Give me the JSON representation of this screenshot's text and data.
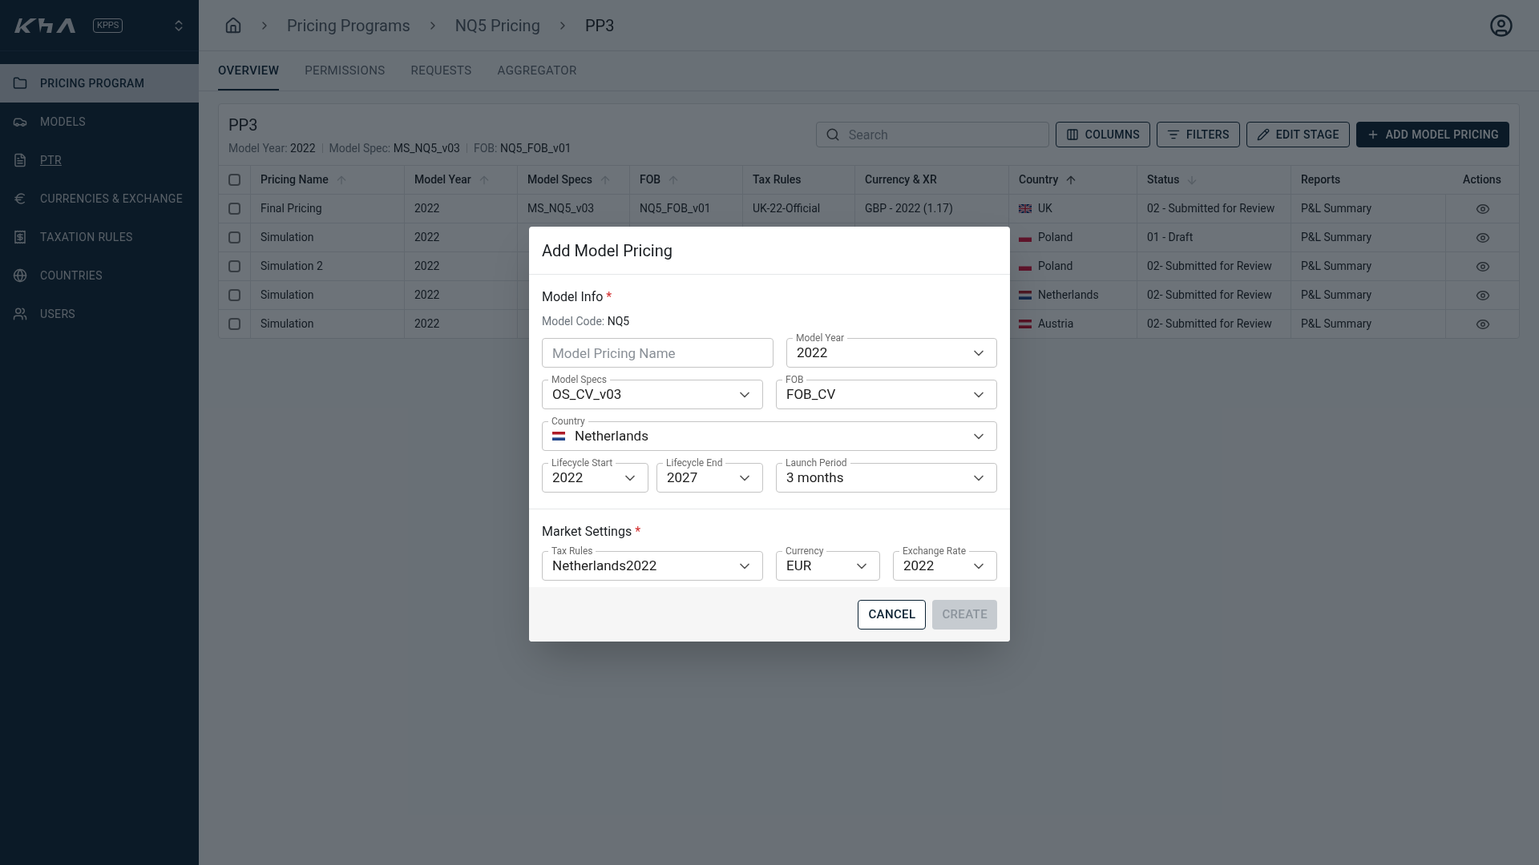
{
  "sidebar": {
    "badge": "KPPS",
    "items": [
      {
        "label": "PRICING PROGRAM",
        "selected": true,
        "link": false
      },
      {
        "label": "MODELS",
        "selected": false,
        "link": false
      },
      {
        "label": "PTR",
        "selected": false,
        "link": true
      },
      {
        "label": "CURRENCIES & EXCHANGE",
        "selected": false,
        "link": false
      },
      {
        "label": "TAXATION RULES",
        "selected": false,
        "link": false
      },
      {
        "label": "COUNTRIES",
        "selected": false,
        "link": false
      },
      {
        "label": "USERS",
        "selected": false,
        "link": false
      }
    ]
  },
  "breadcrumb": [
    "Pricing Programs",
    "NQ5 Pricing",
    "PP3"
  ],
  "tabs": [
    {
      "label": "OVERVIEW",
      "selected": true
    },
    {
      "label": "PERMISSIONS",
      "selected": false
    },
    {
      "label": "REQUESTS",
      "selected": false
    },
    {
      "label": "AGGREGATOR",
      "selected": false
    }
  ],
  "card": {
    "title": "PP3",
    "meta": [
      {
        "label": "Model Year:",
        "value": "2022"
      },
      {
        "label": "Model Spec:",
        "value": "MS_NQ5_v03"
      },
      {
        "label": "FOB:",
        "value": "NQ5_FOB_v01"
      }
    ],
    "search": {
      "placeholder": "Search"
    },
    "buttons": [
      {
        "label": "COLUMNS",
        "kind": "outline"
      },
      {
        "label": "FILTERS",
        "kind": "outline"
      },
      {
        "label": "EDIT STAGE",
        "kind": "outline"
      },
      {
        "label": "ADD MODEL PRICING",
        "kind": "filled"
      }
    ]
  },
  "table": {
    "all_checked": false,
    "columns": [
      {
        "label": "Pricing Name",
        "kind": "sort-up",
        "active": false
      },
      {
        "label": "Model Year",
        "kind": "sort-up",
        "active": false
      },
      {
        "label": "Model Specs",
        "kind": "sort-up",
        "active": false
      },
      {
        "label": "FOB",
        "kind": "sort-up",
        "active": false
      },
      {
        "label": "Tax Rules",
        "kind": "plain"
      },
      {
        "label": "Currency & XR",
        "kind": "plain"
      },
      {
        "label": "Country",
        "kind": "sort-up",
        "active": true
      },
      {
        "label": "Status",
        "kind": "sort-down",
        "active": false
      },
      {
        "label": "Reports",
        "kind": "plain"
      },
      {
        "label": "Actions",
        "kind": "plain"
      }
    ],
    "rows": [
      {
        "checked": false,
        "name": "Final Pricing",
        "year": "2022",
        "specs": "MS_NQ5_v03",
        "fob": "NQ5_FOB_v01",
        "tax": "UK-22-Official",
        "currency": "GBP - 2022 (1.17)",
        "kind": "uk",
        "country": "UK",
        "status": "02 - Submitted for Review",
        "report": "P&L Summary"
      },
      {
        "checked": false,
        "name": "Simulation",
        "year": "2022",
        "kind": "pl",
        "country": "Poland",
        "status": "01 - Draft",
        "report": "P&L Summary"
      },
      {
        "checked": false,
        "name": "Simulation 2",
        "year": "2022",
        "kind": "pl",
        "country": "Poland",
        "status": "02- Submitted for Review",
        "report": "P&L Summary"
      },
      {
        "checked": false,
        "name": "Simulation",
        "year": "2022",
        "kind": "nl",
        "country": "Netherlands",
        "status": "02- Submitted for Review",
        "report": "P&L Summary"
      },
      {
        "checked": false,
        "name": "Simulation",
        "year": "2022",
        "kind": "at",
        "country": "Austria",
        "status": "02- Submitted for Review",
        "report": "P&L Summary"
      }
    ]
  },
  "dialog": {
    "title": "Add Model Pricing",
    "section1": {
      "title": "Model Info",
      "marker": "*",
      "code_label": "Model Code:",
      "code": "NQ5"
    },
    "name_field": {
      "placeholder": "Model Pricing Name"
    },
    "model_year": {
      "label": "Model Year",
      "value": "2022"
    },
    "model_specs": {
      "label": "Model Specs",
      "value": "OS_CV_v03"
    },
    "fob": {
      "label": "FOB",
      "value": "FOB_CV"
    },
    "country": {
      "label": "Country",
      "value": "Netherlands",
      "kind": "nl"
    },
    "lifecycle_start": {
      "label": "Lifecycle Start",
      "value": "2022"
    },
    "lifecycle_end": {
      "label": "Lifecycle End",
      "value": "2027"
    },
    "launch_period": {
      "label": "Launch Period",
      "value": "3 months"
    },
    "section2": {
      "title": "Market Settings",
      "marker": "*"
    },
    "tax_rules": {
      "label": "Tax Rules",
      "value": "Netherlands2022"
    },
    "currency": {
      "label": "Currency",
      "value": "EUR"
    },
    "exchange_rate": {
      "label": "Exchange Rate",
      "value": "2022"
    },
    "cancel": {
      "label": "CANCEL",
      "disabled": false
    },
    "create": {
      "label": "CREATE",
      "disabled": true
    }
  }
}
